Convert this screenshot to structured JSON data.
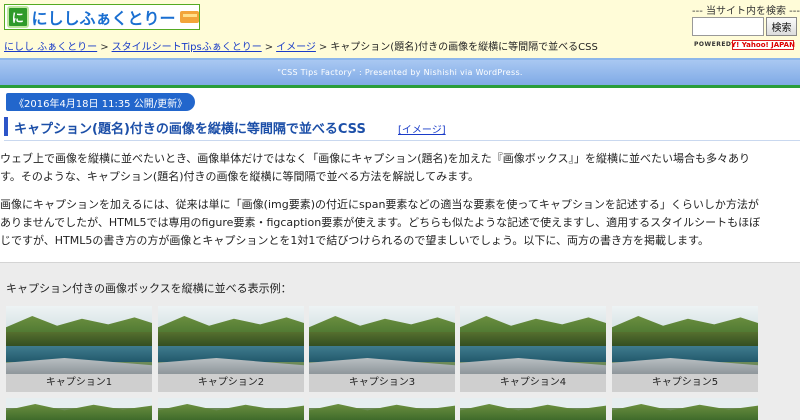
{
  "header": {
    "logo_mark": "に",
    "logo_text": "にししふぁくとりー",
    "site_search_label": "--- 当サイト内を検索 ---",
    "search": {
      "placeholder": "",
      "button_label": "検索"
    },
    "powered_label": "POWERED BY",
    "yahoo_logo": "Y! Yahoo! JAPAN"
  },
  "breadcrumb": {
    "items": [
      "にしし ふぁくとりー",
      "スタイルシートTipsふぁくとりー",
      "イメージ"
    ],
    "separator": ">",
    "current": "キャプション(題名)付きの画像を縦横に等間隔で並べるCSS"
  },
  "band": {
    "text": "\"CSS Tips Factory\" : Presented by Nishishi via WordPress."
  },
  "post": {
    "date": "《2016年4月18日 11:35 公開/更新》",
    "title": "キャプション(題名)付きの画像を縦横に等間隔で並べるCSS",
    "category": "[イメージ]",
    "paragraphs": [
      "ウェブ上で画像を縦横に並べたいとき、画像単体だけではなく「画像にキャプション(題名)を加えた『画像ボックス』」を縦横に並べたい場合も多々あり",
      "す。そのような、キャプション(題名)付きの画像を縦横に等間隔で並べる方法を解説してみます。",
      "画像にキャプションを加えるには、従来は単に「画像(img要素)の付近にspan要素などの適当な要素を使ってキャプションを記述する」くらいしか方法が",
      "ありませんでしたが、HTML5では専用のfigure要素・figcaption要素が使えます。どちらも似たような記述で使えますし、適用するスタイルシートもほぼ",
      "じですが、HTML5の書き方の方が画像とキャプションとを1対1で結びつけられるので望ましいでしょう。以下に、両方の書き方を掲載します。"
    ]
  },
  "example": {
    "label": "キャプション付きの画像ボックスを縦横に並べる表示例：",
    "captions": [
      "キャプション1",
      "キャプション2",
      "キャプション3",
      "キャプション4",
      "キャプション5"
    ]
  },
  "colors": {
    "header_bg": "#fffcd8",
    "band": "#8fb4ec",
    "accent_green": "#2a9d3a",
    "link": "#1a3cc8",
    "title": "#1c4fa8",
    "date_pill": "#2266cc"
  }
}
